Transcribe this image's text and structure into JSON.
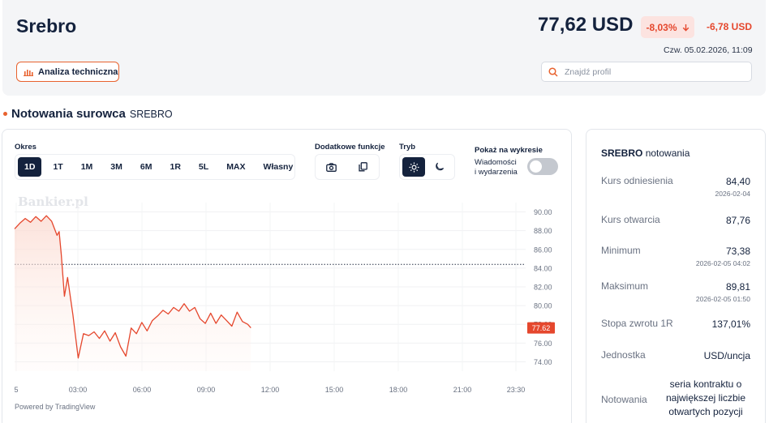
{
  "header": {
    "title": "Srebro",
    "price": "77,62 USD",
    "change_pct": "-8,03%",
    "change_abs": "-6,78 USD",
    "datetime": "Czw. 05.02.2026, 11:09",
    "ta_button": "Analiza techniczna",
    "search_placeholder": "Znajdź profil",
    "down_color": "#e5472d"
  },
  "section": {
    "title": "Notowania surowca",
    "subtitle": "SREBRO"
  },
  "chart_panel": {
    "okres_label": "Okres",
    "periods": [
      "1D",
      "1T",
      "1M",
      "3M",
      "6M",
      "1R",
      "5L",
      "MAX",
      "Własny"
    ],
    "active_period": "1D",
    "extra_label": "Dodatkowe funkcje",
    "mode_label": "Tryb",
    "toggle_title": "Pokaż na wykresie",
    "toggle_text_1": "Wiadomości",
    "toggle_text_2": "i wydarzenia",
    "watermark": "Bankier.pl",
    "powered": "Powered by TradingView"
  },
  "chart_data": {
    "type": "area",
    "x_ticks": [
      "5",
      "03:00",
      "06:00",
      "09:00",
      "12:00",
      "15:00",
      "18:00",
      "21:00",
      "23:30"
    ],
    "y_ticks": [
      "90.00",
      "88.00",
      "86.00",
      "84.00",
      "82.00",
      "80.00",
      "78.00",
      "76.00",
      "74.00"
    ],
    "ylim": [
      73,
      91
    ],
    "reference_line": 84.4,
    "last_price_label": "77.62",
    "line_color": "#e5472d",
    "series": [
      {
        "x": [
          0,
          0.25,
          0.5,
          0.75,
          1.0,
          1.25,
          1.5,
          1.75,
          2.0,
          2.1,
          2.2,
          2.35,
          2.5,
          2.75,
          3.0,
          3.25,
          3.5,
          3.75,
          4.0,
          4.25,
          4.5,
          4.75,
          5.0,
          5.25,
          5.5,
          5.75,
          6.0,
          6.25,
          6.5,
          6.75,
          7.0,
          7.25,
          7.5,
          7.75,
          8.0,
          8.25,
          8.5,
          8.75,
          9.0,
          9.25,
          9.5,
          9.75,
          10.0,
          10.25,
          10.5,
          10.75,
          11.0,
          11.15
        ],
        "y": [
          88.2,
          88.8,
          89.3,
          88.9,
          89.5,
          89.0,
          89.6,
          89.0,
          87.5,
          87.9,
          85.5,
          81.0,
          83.0,
          79.0,
          74.4,
          77.0,
          76.8,
          77.2,
          76.5,
          77.3,
          76.2,
          77.1,
          75.6,
          74.6,
          77.6,
          77.0,
          78.2,
          77.3,
          78.4,
          78.9,
          79.5,
          79.1,
          79.8,
          79.4,
          80.2,
          79.4,
          79.8,
          78.6,
          78.1,
          79.2,
          78.1,
          79.0,
          78.4,
          77.8,
          79.3,
          78.3,
          78.0,
          77.62
        ]
      }
    ]
  },
  "info": {
    "title_bold": "SREBRO",
    "title_rest": "notowania",
    "rows": [
      {
        "label": "Kurs odniesienia",
        "value": "84,40",
        "date": "2026-02-04"
      },
      {
        "label": "Kurs otwarcia",
        "value": "87,76",
        "date": ""
      },
      {
        "label": "Minimum",
        "value": "73,38",
        "date": "2026-02-05 04:02"
      },
      {
        "label": "Maksimum",
        "value": "89,81",
        "date": "2026-02-05 01:50"
      },
      {
        "label": "Stopa zwrotu 1R",
        "value": "137,01%",
        "date": ""
      },
      {
        "label": "Jednostka",
        "value": "USD/uncja",
        "date": ""
      }
    ],
    "last_label": "Notowania",
    "last_value": "seria kontraktu o największej liczbie otwartych pozycji"
  }
}
